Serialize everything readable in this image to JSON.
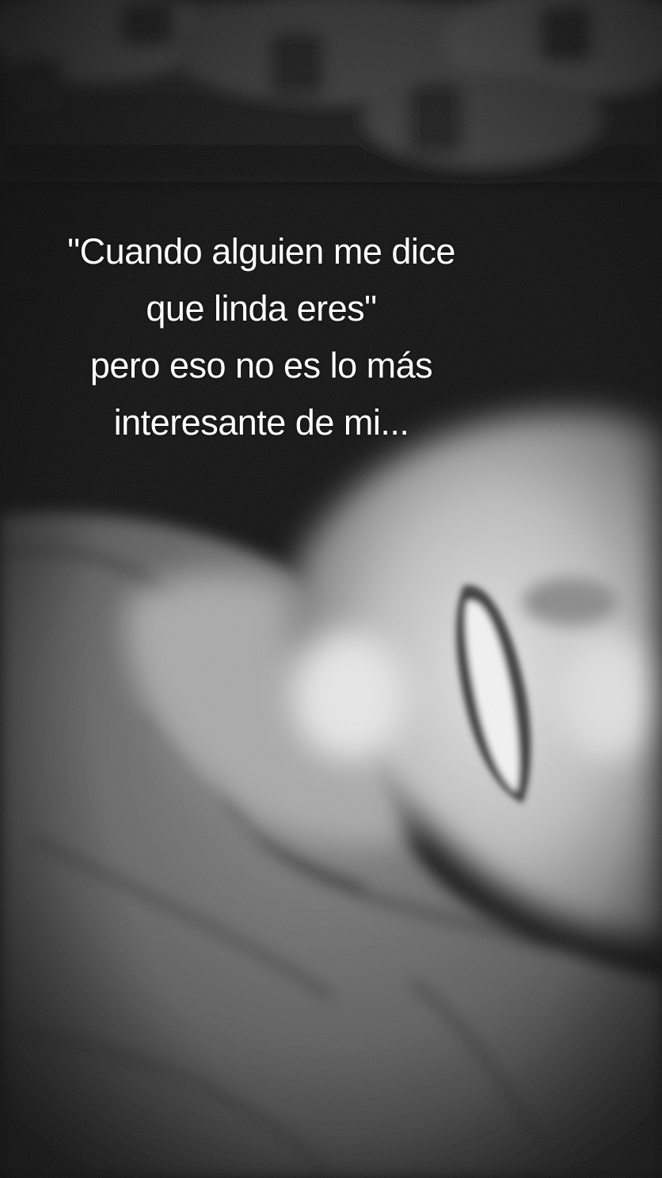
{
  "caption": {
    "line_1": "\"Cuando alguien me dice",
    "line_2": "que linda eres\"",
    "line_3": "pero eso no es lo más",
    "line_4": "interesante de mi..."
  },
  "colors": {
    "background": "#0e0e0e",
    "text": "#ffffff",
    "skin_highlight": "#d8d8d8",
    "fabric": "#6e6e6e"
  }
}
